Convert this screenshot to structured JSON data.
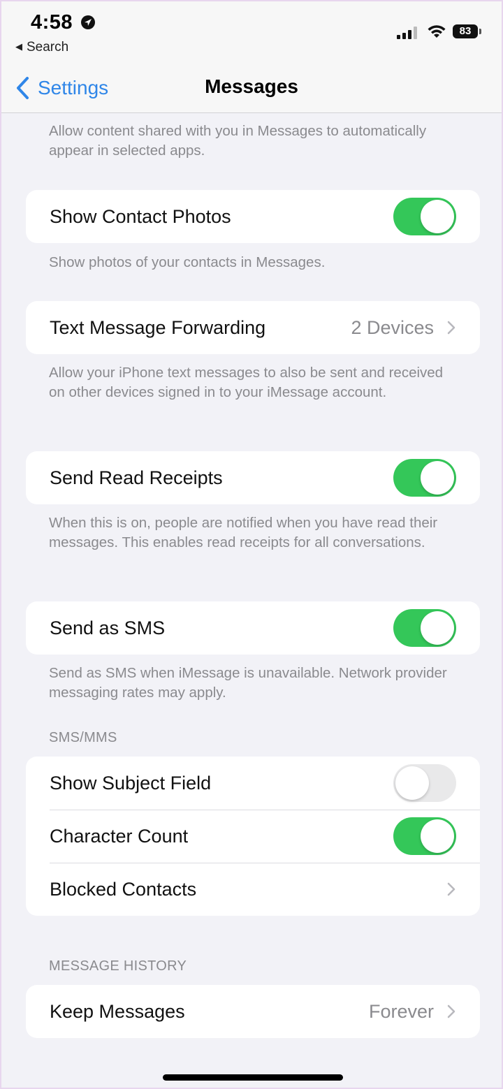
{
  "status_bar": {
    "time": "4:58",
    "back_app": "Search",
    "battery": "83"
  },
  "nav": {
    "back_label": "Settings",
    "title": "Messages"
  },
  "shared_footer": "Allow content shared with you in Messages to automatically appear in selected apps.",
  "show_contact_photos": {
    "label": "Show Contact Photos",
    "on": true,
    "footer": "Show photos of your contacts in Messages."
  },
  "text_forwarding": {
    "label": "Text Message Forwarding",
    "value": "2 Devices",
    "footer": "Allow your iPhone text messages to also be sent and received on other devices signed in to your iMessage account."
  },
  "read_receipts": {
    "label": "Send Read Receipts",
    "on": true,
    "footer": "When this is on, people are notified when you have read their messages. This enables read receipts for all conversations."
  },
  "send_as_sms": {
    "label": "Send as SMS",
    "on": true,
    "footer": "Send as SMS when iMessage is unavailable. Network provider messaging rates may apply."
  },
  "sms_mms": {
    "header": "SMS/MMS",
    "subject_field": {
      "label": "Show Subject Field",
      "on": false
    },
    "character_count": {
      "label": "Character Count",
      "on": true
    },
    "blocked_contacts": {
      "label": "Blocked Contacts"
    }
  },
  "message_history": {
    "header": "MESSAGE HISTORY",
    "keep_messages": {
      "label": "Keep Messages",
      "value": "Forever"
    }
  },
  "colors": {
    "accent": "#2f86e8",
    "toggle_on": "#34c759",
    "background": "#f2f2f7"
  }
}
